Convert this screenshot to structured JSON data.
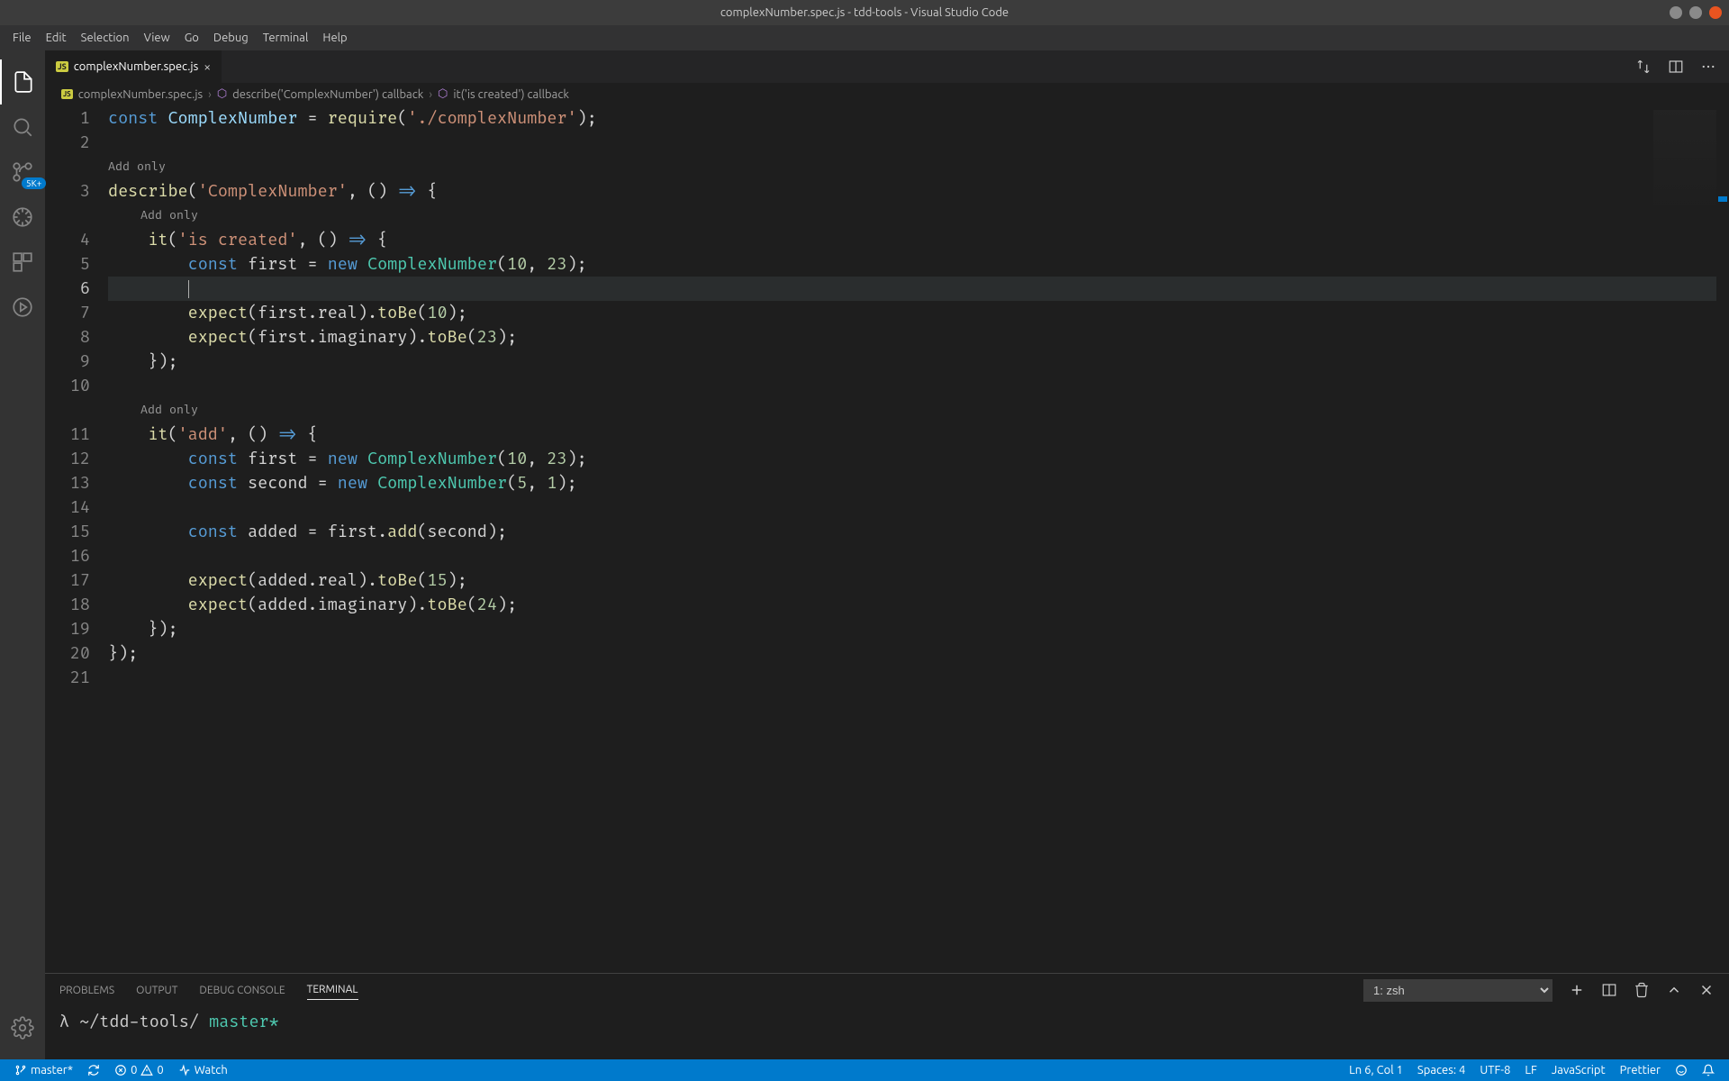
{
  "titlebar": {
    "title": "complexNumber.spec.js - tdd-tools - Visual Studio Code"
  },
  "menu": {
    "items": [
      "File",
      "Edit",
      "Selection",
      "View",
      "Go",
      "Debug",
      "Terminal",
      "Help"
    ]
  },
  "activitybar": {
    "badge": "5K+"
  },
  "tab": {
    "filename": "complexNumber.spec.js"
  },
  "breadcrumb": {
    "file": "complexNumber.spec.js",
    "seg1": "describe('ComplexNumber') callback",
    "seg2": "it('is created') callback"
  },
  "codelens": {
    "label": "Add only"
  },
  "code": {
    "l1": {
      "kw1": "const",
      "var": "ComplexNumber",
      "eq": " = ",
      "fn": "require",
      "p1": "(",
      "str": "'./complexNumber'",
      "p2": ");"
    },
    "l3": {
      "fn": "describe",
      "p1": "(",
      "str": "'ComplexNumber'",
      "rest": ", () ",
      "arrow": "=>",
      "brace": " {"
    },
    "l4": {
      "fn": "it",
      "p1": "(",
      "str": "'is created'",
      "rest": ", () ",
      "arrow": "=>",
      "brace": " {"
    },
    "l5": {
      "indent": "        ",
      "kw": "const",
      "var": " first = ",
      "new": "new",
      "sp": " ",
      "type": "ComplexNumber",
      "p": "(",
      "n1": "10",
      "c": ", ",
      "n2": "23",
      "end": ");"
    },
    "l7": {
      "indent": "        ",
      "fn": "expect",
      "p": "(first.real).",
      "fn2": "toBe",
      "p2": "(",
      "n": "10",
      "end": ");"
    },
    "l8": {
      "indent": "        ",
      "fn": "expect",
      "p": "(first.imaginary).",
      "fn2": "toBe",
      "p2": "(",
      "n": "23",
      "end": ");"
    },
    "l9": {
      "indent": "    });",
      "text": "    });"
    },
    "l11": {
      "fn": "it",
      "p1": "(",
      "str": "'add'",
      "rest": ", () ",
      "arrow": "=>",
      "brace": " {"
    },
    "l12": {
      "indent": "        ",
      "kw": "const",
      "var": " first = ",
      "new": "new",
      "sp": " ",
      "type": "ComplexNumber",
      "p": "(",
      "n1": "10",
      "c": ", ",
      "n2": "23",
      "end": ");"
    },
    "l13": {
      "indent": "        ",
      "kw": "const",
      "var": " second = ",
      "new": "new",
      "sp": " ",
      "type": "ComplexNumber",
      "p": "(",
      "n1": "5",
      "c": ", ",
      "n2": "1",
      "end": ");"
    },
    "l15": {
      "indent": "        ",
      "kw": "const",
      "var": " added = first.",
      "fn": "add",
      "p": "(second);"
    },
    "l17": {
      "indent": "        ",
      "fn": "expect",
      "p": "(added.real).",
      "fn2": "toBe",
      "p2": "(",
      "n": "15",
      "end": ");"
    },
    "l18": {
      "indent": "        ",
      "fn": "expect",
      "p": "(added.imaginary).",
      "fn2": "toBe",
      "p2": "(",
      "n": "24",
      "end": ");"
    },
    "l19": {
      "text": "    });"
    },
    "l20": {
      "text": "});"
    }
  },
  "panel": {
    "tabs": {
      "problems": "PROBLEMS",
      "output": "OUTPUT",
      "debug": "DEBUG CONSOLE",
      "terminal": "TERMINAL"
    },
    "terminal_select": "1: zsh",
    "prompt_symbol": "λ",
    "prompt_path": " ~/tdd-tools/ ",
    "prompt_branch": "master*"
  },
  "statusbar": {
    "branch": "master*",
    "errors": "0",
    "warnings": "0",
    "watch": "Watch",
    "lncol": "Ln 6, Col 1",
    "spaces": "Spaces: 4",
    "encoding": "UTF-8",
    "eol": "LF",
    "lang": "JavaScript",
    "prettier": "Prettier"
  }
}
